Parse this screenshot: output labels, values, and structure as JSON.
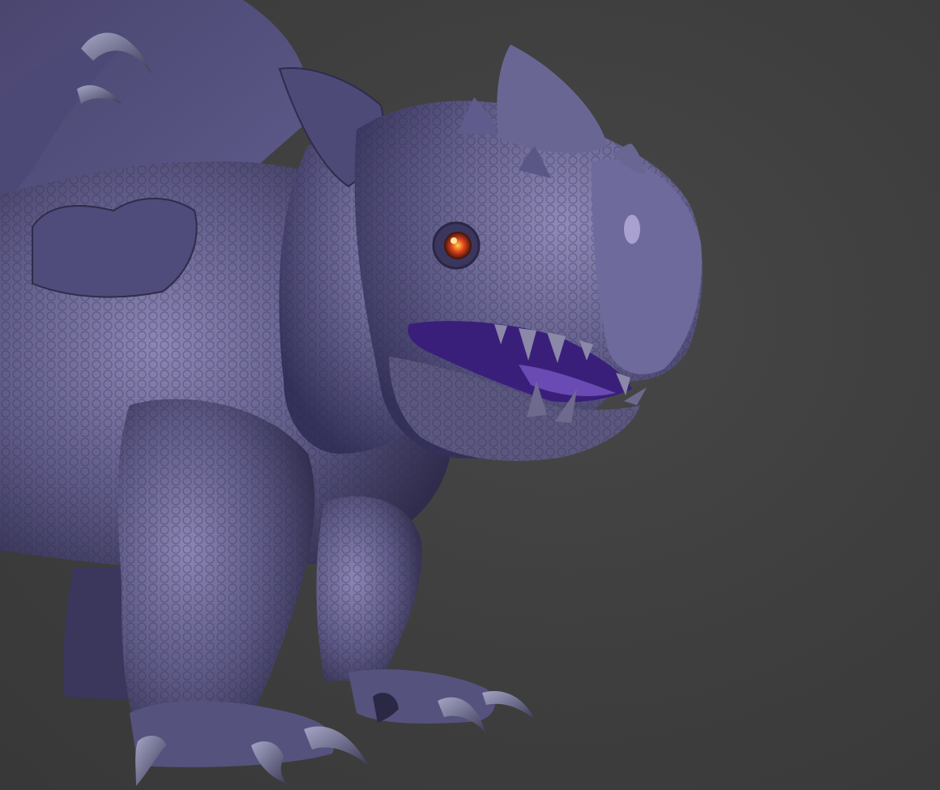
{
  "scene": {
    "subject": "dragon-sculpt",
    "background_color": "#3f3f3f",
    "skin_color": "#5e5a86",
    "skin_shadow_color": "#2f2c4c",
    "skin_light_color": "#8b86b4",
    "claw_color": "#6c6c8e",
    "eye_color": "#e2461d",
    "mouth_color": "#3a1f7a"
  }
}
